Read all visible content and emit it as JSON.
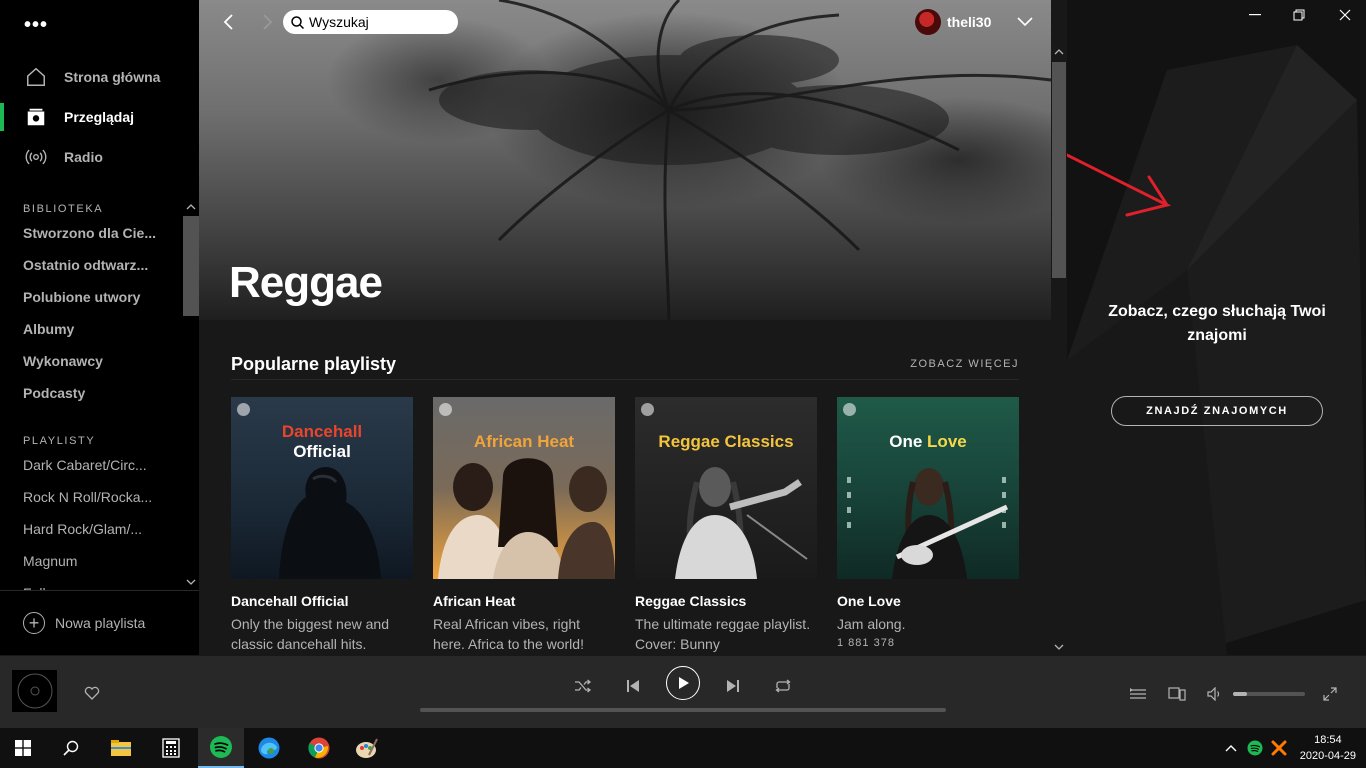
{
  "sidebar": {
    "nav": [
      {
        "label": "Strona główna",
        "icon": "home-icon"
      },
      {
        "label": "Przeglądaj",
        "icon": "browse-icon",
        "active": true
      },
      {
        "label": "Radio",
        "icon": "radio-icon"
      }
    ],
    "library_header": "BIBLIOTEKA",
    "library": [
      "Stworzono dla Cie...",
      "Ostatnio odtwarz...",
      "Polubione utwory",
      "Albumy",
      "Wykonawcy",
      "Podcasty"
    ],
    "playlists_header": "PLAYLISTY",
    "playlists": [
      "Dark Cabaret/Circ...",
      "Rock N Roll/Rocka...",
      "Hard Rock/Glam/...",
      "Magnum",
      "Folk"
    ],
    "new_playlist": "Nowa playlista"
  },
  "topbar": {
    "search_value": "Wyszukaj",
    "username": "theli30"
  },
  "hero": {
    "title": "Reggae"
  },
  "section": {
    "title": "Popularne playlisty",
    "see_more": "ZOBACZ WIĘCEJ"
  },
  "cards": [
    {
      "cover_line1": "Dancehall",
      "cover_line2": "Official",
      "name": "Dancehall Official",
      "desc": "Only the biggest new and classic dancehall hits.",
      "count": ""
    },
    {
      "cover_line1": "African Heat",
      "cover_line2": "",
      "name": "African Heat",
      "desc": "Real African vibes, right here. Africa to the world!",
      "count": ""
    },
    {
      "cover_line1": "Reggae Classics",
      "cover_line2": "",
      "name": "Reggae Classics",
      "desc": "The ultimate reggae playlist. Cover: Bunny",
      "count": ""
    },
    {
      "cover_line1": "One Love",
      "cover_line2": "",
      "name": "One Love",
      "desc": "Jam along.",
      "count": "1 881 378"
    }
  ],
  "right_panel": {
    "heading": "Zobacz, czego słuchają Twoi znajomi",
    "button": "ZNAJDŹ ZNAJOMYCH"
  },
  "player": {
    "volume": 0.2,
    "progress": 0
  },
  "taskbar": {
    "time": "18:54",
    "date": "2020-04-29"
  },
  "colors": {
    "accent": "#1db954",
    "annotation_arrow": "#e0212b",
    "dancehall_red": "#e8452c",
    "african_heat_orange": "#f0a43c",
    "reggae_classics_yellow": "#f3c43c",
    "one_love_yellow": "#f5d84a"
  }
}
